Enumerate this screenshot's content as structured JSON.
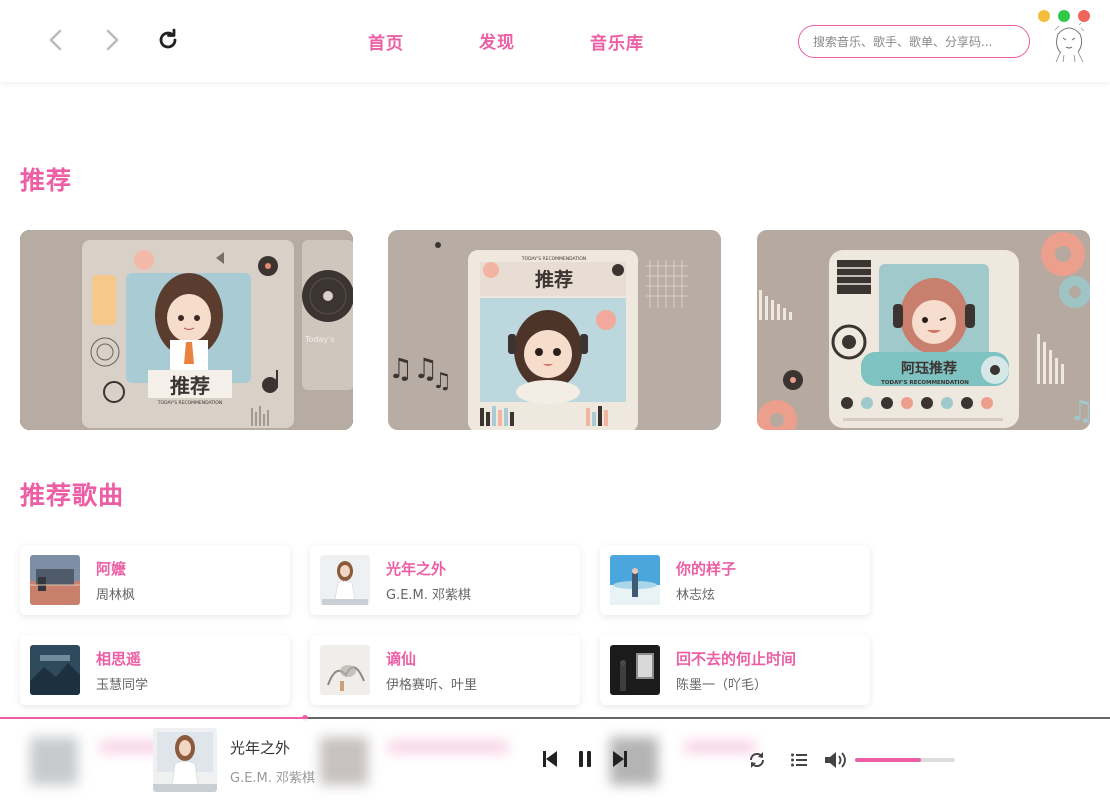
{
  "header": {
    "tabs": [
      {
        "label": "首页"
      },
      {
        "label": "发现"
      },
      {
        "label": "音乐库"
      }
    ],
    "search_placeholder": "搜索音乐、歌手、歌单、分享码...",
    "window_controls": {
      "minimize_color": "#f5bd3c",
      "maximize_color": "#2fc849",
      "close_color": "#f2645a"
    }
  },
  "recommend": {
    "title": "推荐",
    "banners": [
      {
        "art_text": "推荐",
        "art_subtitle": "TODAY'S RECOMMENDATION",
        "side_text": "Today's"
      },
      {
        "art_text": "推荐",
        "art_subtitle": "TODAY'S RECOMMENDATION"
      },
      {
        "art_text": "阿珏推荐",
        "art_subtitle": "TODAY'S RECOMMENDATION"
      }
    ]
  },
  "songs": {
    "title": "推荐歌曲",
    "items": [
      {
        "title": "阿嬷",
        "artist": "周林枫"
      },
      {
        "title": "光年之外",
        "artist": "G.E.M. 邓紫棋"
      },
      {
        "title": "你的样子",
        "artist": "林志炫"
      },
      {
        "title": "相思遥",
        "artist": "玉慧同学"
      },
      {
        "title": "谪仙",
        "artist": "伊格赛听、叶里"
      },
      {
        "title": "回不去的何止时间",
        "artist": "陈墨一（吖毛）"
      }
    ]
  },
  "player": {
    "title": "光年之外",
    "artist": "G.E.M. 邓紫棋",
    "progress": 0.275,
    "volume": 0.66
  },
  "colors": {
    "accent": "#ec5fa4"
  }
}
